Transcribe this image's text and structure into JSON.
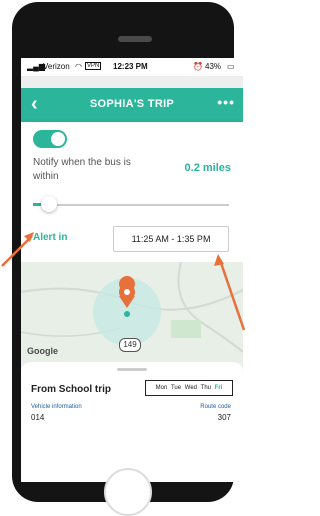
{
  "status_bar": {
    "carrier": "Verizon",
    "vpn": "VPN",
    "time": "12:23 PM",
    "battery": "43%"
  },
  "header": {
    "title": "SOPHIA'S TRIP",
    "back_icon": "chevron-left",
    "more_icon": "more-dots"
  },
  "notify": {
    "enabled": true,
    "label": "Notify when the bus is within",
    "distance": "0.2 miles",
    "slider_fraction": 0.05
  },
  "alert": {
    "label": "Alert in",
    "time_range": "11:25 AM - 1:35 PM"
  },
  "map": {
    "provider_label": "Google",
    "route_badge": "149"
  },
  "trip": {
    "title": "From School trip",
    "days": [
      "Mon",
      "Tue",
      "Wed",
      "Thu",
      "Fri"
    ],
    "active_day": "Fri",
    "vehicle_label": "Vehicle information",
    "vehicle_value": "014",
    "route_label": "Route code",
    "route_value": "307"
  },
  "colors": {
    "accent": "#2bb59a",
    "annotation_arrow": "#e8703a"
  }
}
